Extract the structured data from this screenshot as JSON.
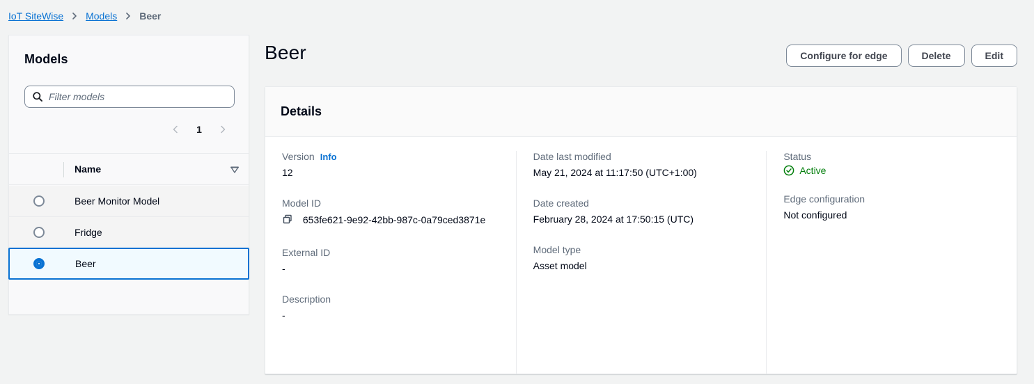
{
  "breadcrumb": {
    "items": [
      {
        "label": "IoT SiteWise",
        "type": "link"
      },
      {
        "label": "Models",
        "type": "link"
      },
      {
        "label": "Beer",
        "type": "current"
      }
    ],
    "separator_icon": "chevron-right-icon"
  },
  "sidebar": {
    "title": "Models",
    "filter": {
      "placeholder": "Filter models",
      "value": "",
      "icon": "search-icon"
    },
    "pagination": {
      "prev_icon": "chevron-left-icon",
      "next_icon": "chevron-right-icon",
      "current_page": "1"
    },
    "table": {
      "column_header": "Name",
      "sort_icon": "sort-descending-icon",
      "rows": [
        {
          "name": "Beer Monitor Model",
          "selected": false
        },
        {
          "name": "Fridge",
          "selected": false
        },
        {
          "name": "Beer",
          "selected": true
        }
      ]
    }
  },
  "header": {
    "title": "Beer",
    "buttons": [
      {
        "label": "Configure for edge"
      },
      {
        "label": "Delete"
      },
      {
        "label": "Edit"
      }
    ]
  },
  "details": {
    "panel_title": "Details",
    "column1": {
      "version": {
        "label": "Version",
        "info_label": "Info",
        "value": "12"
      },
      "model_id": {
        "label": "Model ID",
        "value": "653fe621-9e92-42bb-987c-0a79ced3871e",
        "copy_icon": "copy-icon"
      },
      "external_id": {
        "label": "External ID",
        "value": "-"
      },
      "description": {
        "label": "Description",
        "value": "-"
      }
    },
    "column2": {
      "date_last_modified": {
        "label": "Date last modified",
        "value": "May 21, 2024 at 11:17:50 (UTC+1:00)"
      },
      "date_created": {
        "label": "Date created",
        "value": "February 28, 2024 at 17:50:15 (UTC)"
      },
      "model_type": {
        "label": "Model type",
        "value": "Asset model"
      }
    },
    "column3": {
      "status": {
        "label": "Status",
        "value": "Active",
        "icon": "status-positive-icon",
        "color": "#037f0c"
      },
      "edge_configuration": {
        "label": "Edge configuration",
        "value": "Not configured"
      }
    }
  },
  "colors": {
    "link": "#0972d3",
    "selected_row_bg": "#f1faff",
    "page_bg": "#f2f3f3",
    "status_green": "#037f0c"
  }
}
